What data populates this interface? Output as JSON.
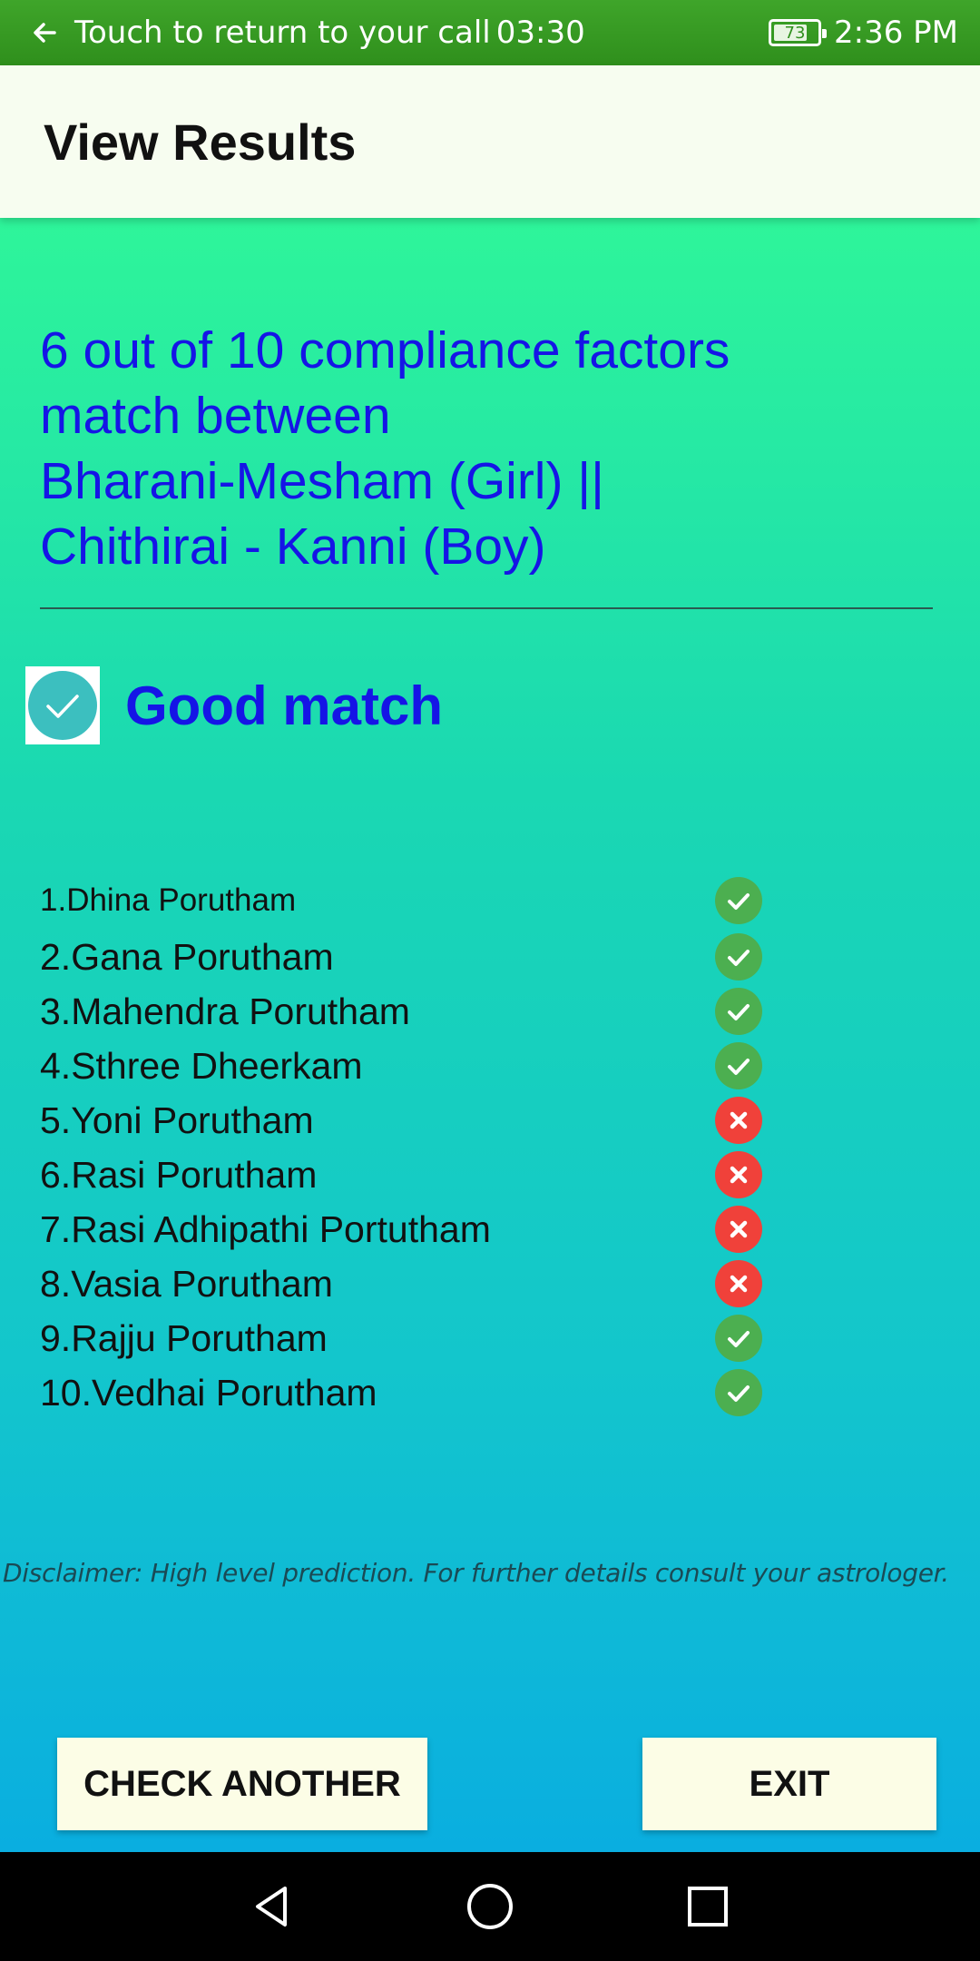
{
  "status_bar": {
    "call_text": "Touch to return to your call",
    "call_timer": "03:30",
    "battery_level": "73",
    "time": "2:36 PM"
  },
  "app_bar": {
    "title": "View Results"
  },
  "result": {
    "headline_line1": "6 out of 10 compliance factors",
    "headline_line2": "match between",
    "headline_line3": "Bharani-Mesham (Girl) ||",
    "headline_line4": "Chithirai - Kanni (Boy)",
    "verdict": "Good match",
    "matched_count": 6,
    "total_count": 10
  },
  "factors": [
    {
      "label": "1.Dhina Porutham",
      "match": true
    },
    {
      "label": "2.Gana Porutham",
      "match": true
    },
    {
      "label": "3.Mahendra Porutham",
      "match": true
    },
    {
      "label": "4.Sthree Dheerkam",
      "match": true
    },
    {
      "label": "5.Yoni Porutham",
      "match": false
    },
    {
      "label": "6.Rasi Porutham",
      "match": false
    },
    {
      "label": "7.Rasi Adhipathi Portutham",
      "match": false
    },
    {
      "label": "8.Vasia Porutham",
      "match": false
    },
    {
      "label": "9.Rajju Porutham",
      "match": true
    },
    {
      "label": "10.Vedhai Porutham",
      "match": true
    }
  ],
  "disclaimer": "Disclaimer: High level prediction. For further details consult your astrologer.",
  "buttons": {
    "check_another": "CHECK ANOTHER",
    "exit": "EXIT"
  },
  "colors": {
    "status_bar": "#2f8f1c",
    "headline": "#1515e6",
    "match_ok": "#4caf50",
    "match_bad": "#f0413a",
    "button_bg": "#fcfde6"
  }
}
